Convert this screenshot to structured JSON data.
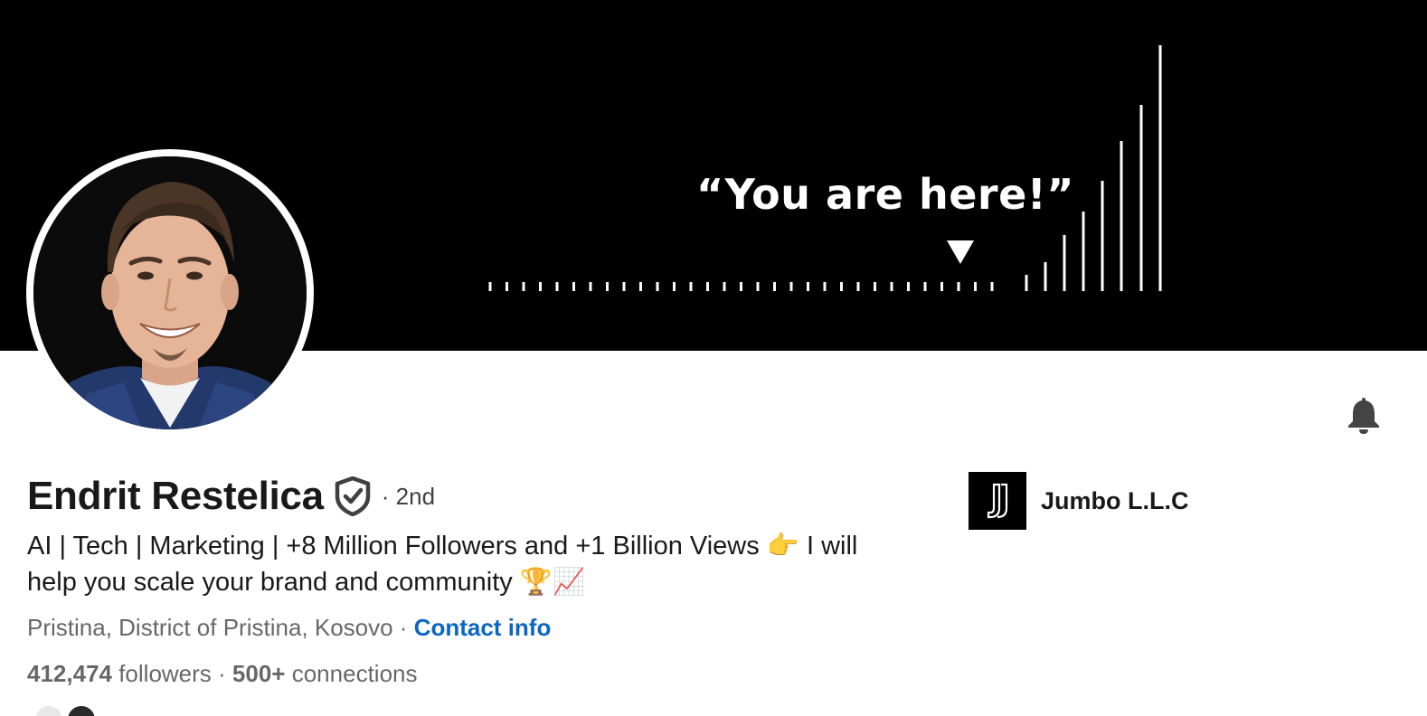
{
  "banner": {
    "quote": "“You are here!”"
  },
  "profile": {
    "name": "Endrit Restelica",
    "degree": "· 2nd",
    "headline": "AI | Tech | Marketing | +8 Million Followers and +1 Billion Views 👉 I will help you scale your brand and community 🏆📈",
    "location": "Pristina, District of Pristina, Kosovo",
    "location_separator": " · ",
    "contact_label": "Contact info",
    "followers_count": "412,474",
    "followers_label": " followers",
    "stats_separator": "  · ",
    "connections_count": "500+",
    "connections_label": " connections"
  },
  "company": {
    "name": "Jumbo L.L.C"
  },
  "icons": {
    "bell": "bell-icon",
    "verified": "verified-shield-icon",
    "marker": "down-triangle-icon"
  },
  "colors": {
    "link": "#0a66c2",
    "banner_bg": "#000000"
  }
}
